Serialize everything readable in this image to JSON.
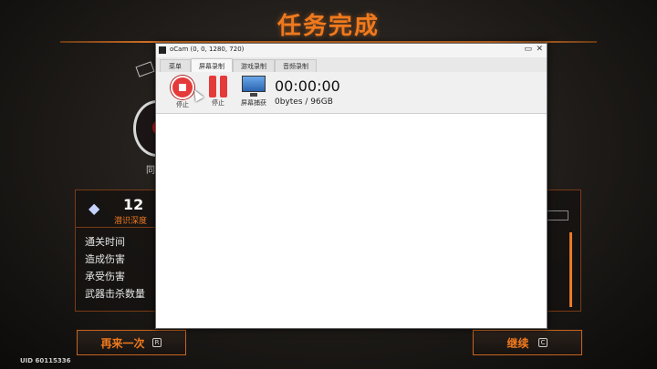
{
  "game": {
    "title": "任务完成",
    "avatar_label": "同",
    "depth_value": "12",
    "depth_label": "潜识深度",
    "stats": [
      "通关时间",
      "造成伤害",
      "承受伤害",
      "武器击杀数量"
    ],
    "retry_label": "再来一次",
    "retry_key": "R",
    "continue_label": "继续",
    "continue_key": "C",
    "uid": "UID 60115336"
  },
  "ocam": {
    "title": "oCam (0, 0, 1280, 720)",
    "tabs": [
      "菜单",
      "屏幕录制",
      "游戏录制",
      "音频录制"
    ],
    "active_tab": 1,
    "tools": [
      {
        "label": "停止",
        "icon": "stop-icon"
      },
      {
        "label": "停止",
        "icon": "pause-icon"
      },
      {
        "label": "屏幕捕获",
        "icon": "monitor-icon"
      }
    ],
    "timer": "00:00:00",
    "size": "0bytes / 96GB"
  },
  "colors": {
    "accent": "#f07a1e",
    "record_red": "#e53a3a"
  }
}
